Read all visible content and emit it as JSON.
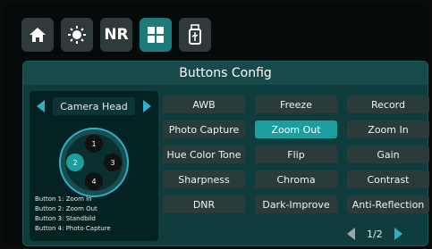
{
  "tabs": [
    {
      "name": "home",
      "icon": "home-icon",
      "active": false
    },
    {
      "name": "brightness",
      "icon": "sun-icon",
      "active": false
    },
    {
      "name": "noise-reduction",
      "icon": "nr-icon",
      "active": false
    },
    {
      "name": "buttons",
      "icon": "grid-icon",
      "active": true
    },
    {
      "name": "usb",
      "icon": "usb-icon",
      "active": false
    }
  ],
  "tab_nr_label": "NR",
  "panel": {
    "title": "Buttons Config"
  },
  "device": {
    "label": "Camera Head"
  },
  "dpad": {
    "top": "1",
    "left": "2",
    "right": "3",
    "bottom": "4",
    "selected": "2"
  },
  "button_assignments": [
    "Button 1: Zoom In",
    "Button 2: Zoom Out",
    "Button 3: Standbild",
    "Button 4: Photo Capture"
  ],
  "functions": [
    "AWB",
    "Freeze",
    "Record",
    "Photo Capture",
    "Zoom Out",
    "Zoom In",
    "Hue Color Tone",
    "Flip",
    "Gain",
    "Sharpness",
    "Chroma",
    "Contrast",
    "DNR",
    "Dark-Improve",
    "Anti-Reflection"
  ],
  "selected_function": "Zoom Out",
  "pager": {
    "text": "1/2"
  },
  "colors": {
    "accent": "#1c9e9e",
    "panel": "#0f3c3c",
    "button": "#2b3a3a"
  }
}
